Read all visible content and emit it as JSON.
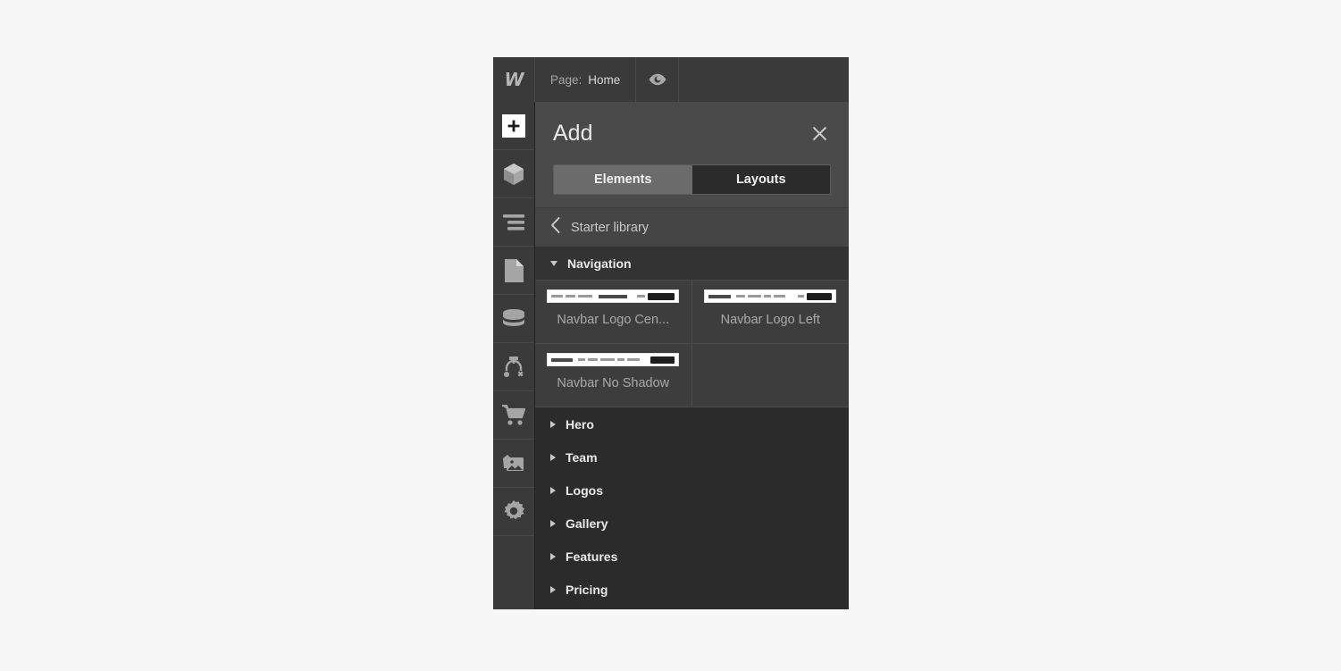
{
  "topbar": {
    "logo_icon": "webflow-logo-icon",
    "page_label": "Page:",
    "page_value": "Home",
    "preview_icon": "eye-icon"
  },
  "rail": {
    "items": [
      {
        "icon": "plus-icon",
        "name": "add-panel",
        "active": true
      },
      {
        "icon": "components-box-icon",
        "name": "components-panel",
        "active": false
      },
      {
        "icon": "navigator-lines-icon",
        "name": "navigator-panel",
        "active": false
      },
      {
        "icon": "page-document-icon",
        "name": "pages-panel",
        "active": false
      },
      {
        "icon": "database-stack-icon",
        "name": "cms-panel",
        "active": false
      },
      {
        "icon": "data-binding-icon",
        "name": "bindings-panel",
        "active": false
      },
      {
        "icon": "shopping-cart-icon",
        "name": "ecommerce-panel",
        "active": false
      },
      {
        "icon": "image-assets-icon",
        "name": "assets-panel",
        "active": false
      },
      {
        "icon": "gear-icon",
        "name": "settings-panel",
        "active": false
      }
    ]
  },
  "panel": {
    "title": "Add",
    "close_icon": "close-icon",
    "tabs": [
      {
        "label": "Elements",
        "active": false
      },
      {
        "label": "Layouts",
        "active": true
      }
    ],
    "breadcrumb": {
      "back_icon": "chevron-left-icon",
      "label": "Starter library"
    },
    "groups": [
      {
        "label": "Navigation",
        "expanded": true,
        "items": [
          {
            "label": "Navbar Logo Cen...",
            "thumb": "navbar-logo-center"
          },
          {
            "label": "Navbar Logo Left",
            "thumb": "navbar-logo-left"
          },
          {
            "label": "Navbar No Shadow",
            "thumb": "navbar-no-shadow"
          },
          {
            "label": "",
            "thumb": ""
          }
        ]
      },
      {
        "label": "Hero",
        "expanded": false,
        "items": []
      },
      {
        "label": "Team",
        "expanded": false,
        "items": []
      },
      {
        "label": "Logos",
        "expanded": false,
        "items": []
      },
      {
        "label": "Gallery",
        "expanded": false,
        "items": []
      },
      {
        "label": "Features",
        "expanded": false,
        "items": []
      },
      {
        "label": "Pricing",
        "expanded": false,
        "items": []
      }
    ]
  },
  "colors": {
    "panel_bg": "#2b2b2b",
    "chrome_bg": "#3a3a3a",
    "head_bg": "#4a4a4a",
    "cell_bg": "#3d3d3d",
    "active_tab_bg": "#2b2b2b",
    "inactive_tab_bg": "#6b6b6b",
    "text": "#e8e8e8",
    "muted_text": "#a9a9a9"
  }
}
